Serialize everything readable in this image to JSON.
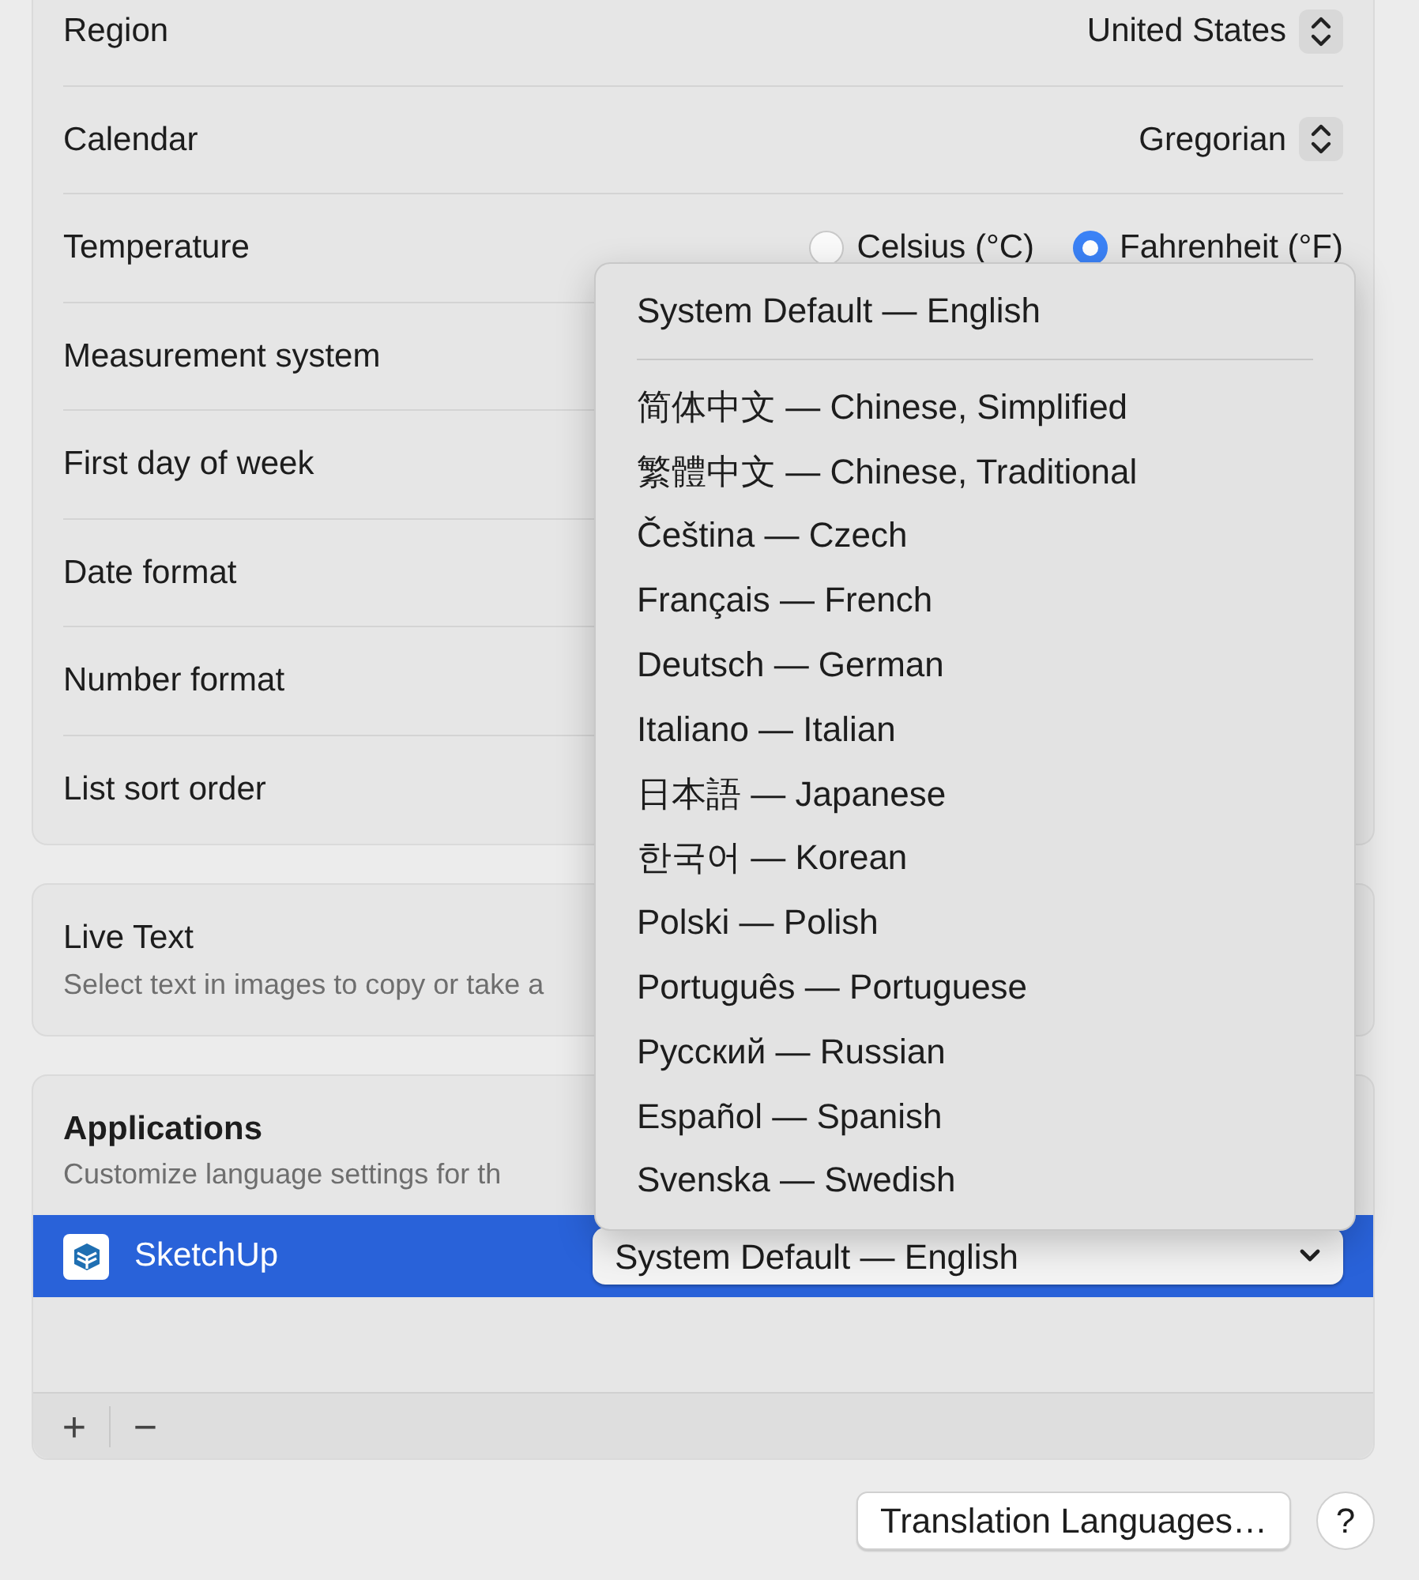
{
  "settings": [
    {
      "label": "Region",
      "kind": "popup",
      "value": "United States"
    },
    {
      "label": "Calendar",
      "kind": "popup",
      "value": "Gregorian"
    },
    {
      "label": "Temperature",
      "kind": "radio",
      "options": [
        {
          "label": "Celsius (°C)",
          "selected": false
        },
        {
          "label": "Fahrenheit (°F)",
          "selected": true
        }
      ]
    },
    {
      "label": "Measurement system",
      "kind": "plain"
    },
    {
      "label": "First day of week",
      "kind": "plain"
    },
    {
      "label": "Date format",
      "kind": "plain"
    },
    {
      "label": "Number format",
      "kind": "plain"
    },
    {
      "label": "List sort order",
      "kind": "plain"
    }
  ],
  "live_text": {
    "title": "Live Text",
    "description": "Select text in images to copy or take a"
  },
  "applications": {
    "title": "Applications",
    "description": "Customize language settings for th",
    "apps": [
      {
        "name": "SketchUp",
        "selected": true,
        "language": "System Default — English"
      }
    ],
    "footer_buttons": [
      "+",
      "−"
    ]
  },
  "language_menu": {
    "groups": [
      [
        "System Default — English"
      ],
      [
        "简体中文 — Chinese, Simplified",
        "繁體中文 — Chinese, Traditional",
        "Čeština — Czech",
        "Français — French",
        "Deutsch — German",
        "Italiano — Italian",
        "日本語 — Japanese",
        "한국어 — Korean",
        "Polski — Polish",
        "Português — Portuguese",
        "Русский — Russian",
        "Español — Spanish",
        "Svenska — Swedish"
      ]
    ]
  },
  "buttons": {
    "translation": "Translation Languages…",
    "help": "?"
  }
}
